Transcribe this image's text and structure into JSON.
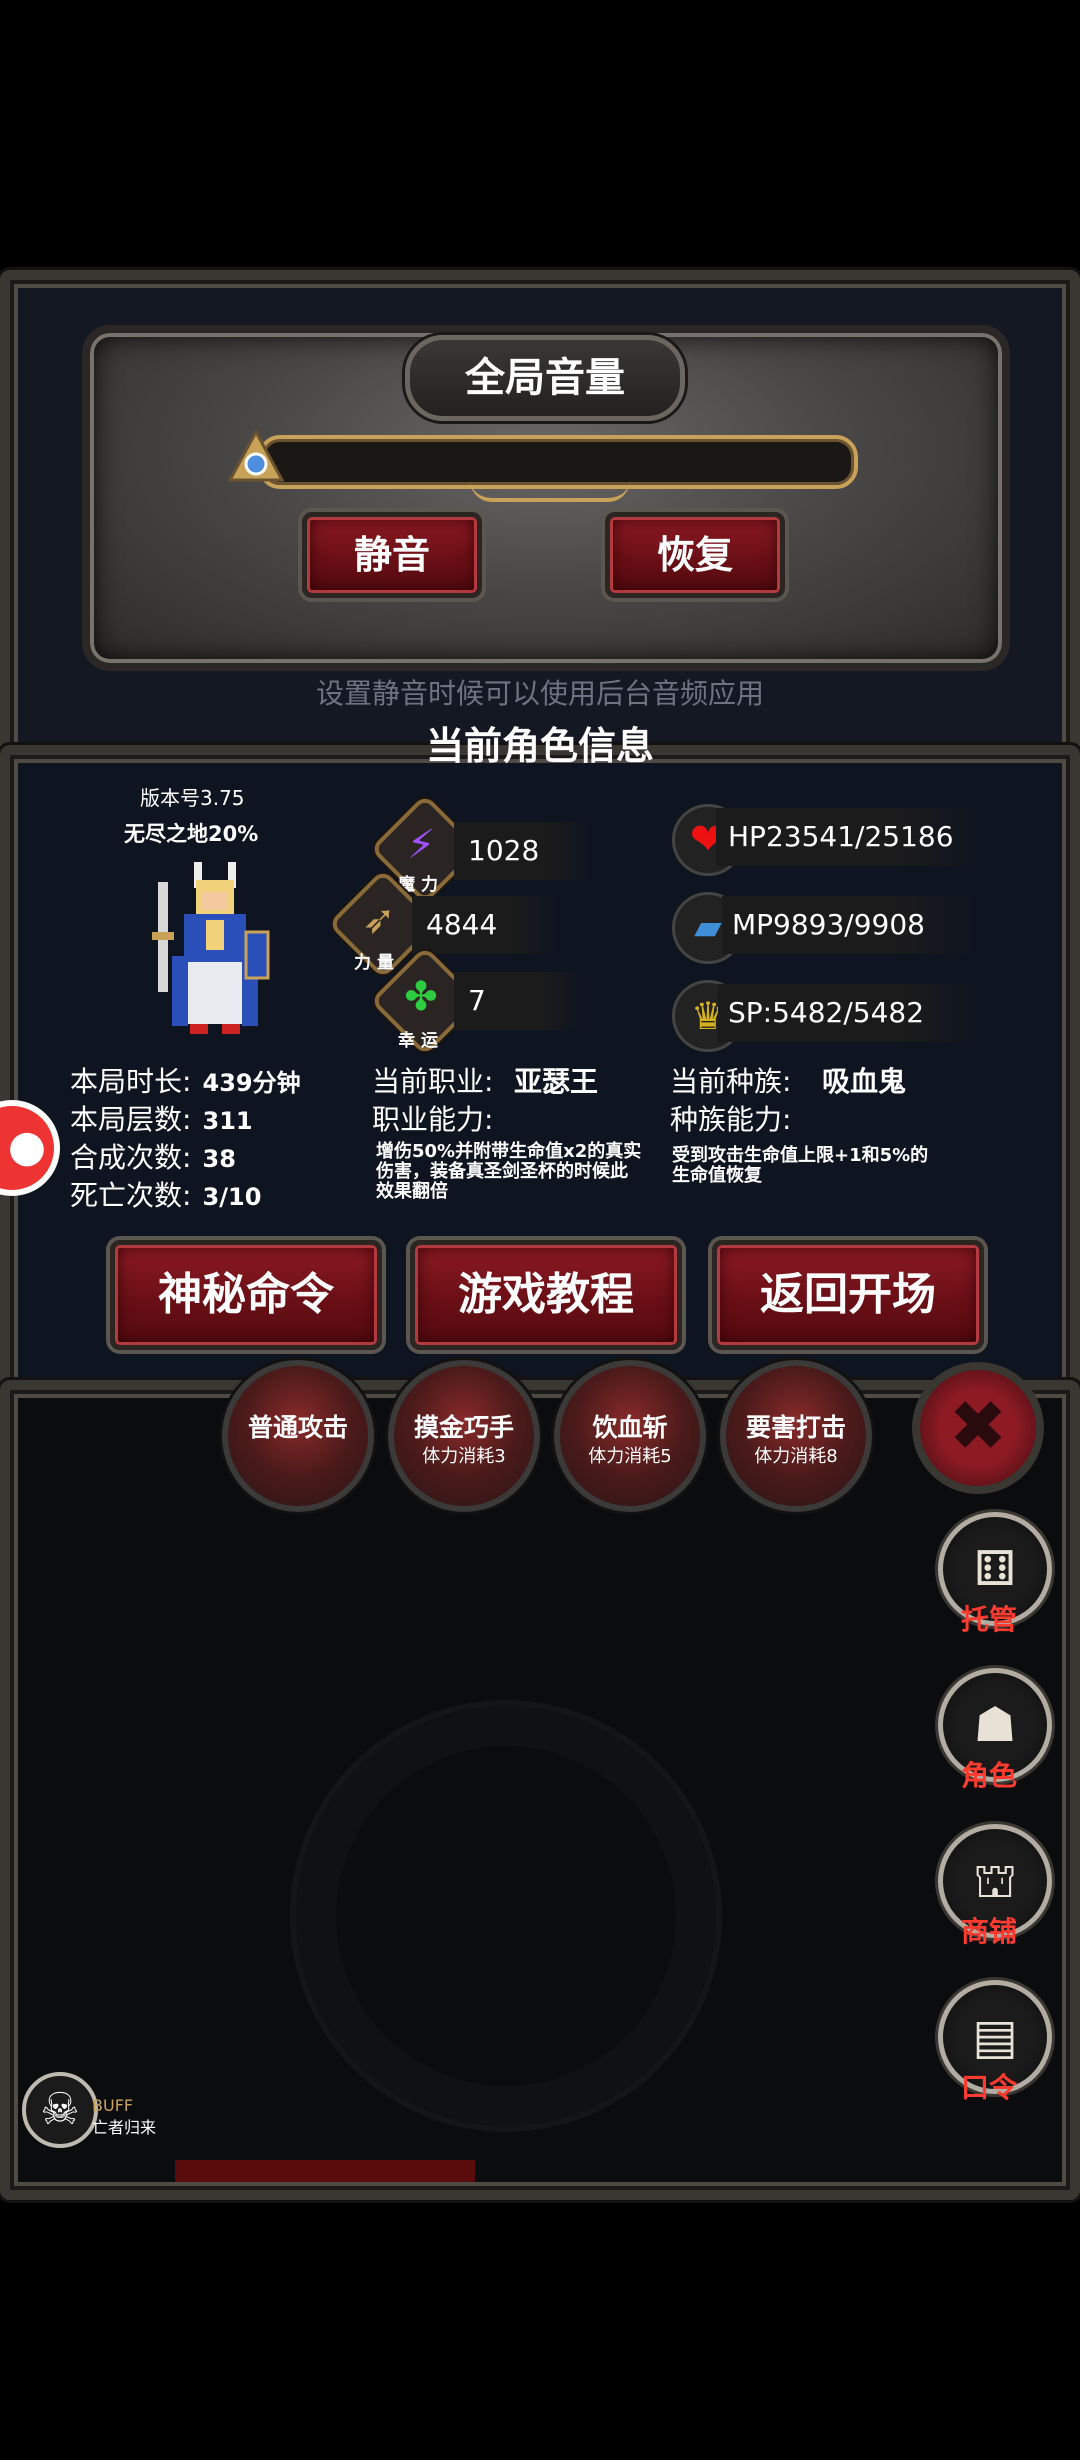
{
  "volume_panel": {
    "title": "全局音量",
    "mute_label": "静音",
    "restore_label": "恢复",
    "hint": "设置静音时候可以使用后台音频应用"
  },
  "character": {
    "section_title": "当前角色信息",
    "version": "版本号3.75",
    "mode": "无尽之地20%",
    "magic": {
      "value": "1028",
      "label": "魔 力"
    },
    "strength": {
      "value": "4844",
      "label": "力 量"
    },
    "luck": {
      "value": "7",
      "label": "幸 运"
    },
    "hp": "HP23541/25186",
    "mp": "MP9893/9908",
    "sp": "SP:5482/5482",
    "stats": [
      {
        "label": "本局时长:",
        "value": "439分钟"
      },
      {
        "label": "本局层数:",
        "value": "311"
      },
      {
        "label": "合成次数:",
        "value": "38"
      },
      {
        "label": "死亡次数:",
        "value": "3/10"
      }
    ],
    "job_label": "当前职业:",
    "job_value": "亚瑟王",
    "job_ability_label": "职业能力:",
    "job_ability_desc": "增伤50%并附带生命值x2的真实伤害，装备真圣剑圣杯的时候此效果翻倍",
    "race_label": "当前种族:",
    "race_value": "吸血鬼",
    "race_ability_label": "种族能力:",
    "race_ability_desc": "受到攻击生命值上限+1和5%的生命值恢复"
  },
  "menu_buttons": {
    "secret": "神秘命令",
    "tutorial": "游戏教程",
    "back": "返回开场"
  },
  "skills": [
    {
      "name": "普通攻击",
      "cost": ""
    },
    {
      "name": "摸金巧手",
      "cost": "体力消耗3"
    },
    {
      "name": "饮血斩",
      "cost": "体力消耗5"
    },
    {
      "name": "要害打击",
      "cost": "体力消耗8"
    }
  ],
  "side_menu": {
    "auto": "托管",
    "role": "角色",
    "shop": "商铺",
    "code": "口令"
  },
  "buff": {
    "title": "BUFF",
    "name": "亡者归来"
  },
  "colors": {
    "accent_red": "#8e1b24",
    "side_label_red": "#ff3b30",
    "gold": "#c9a25a"
  }
}
